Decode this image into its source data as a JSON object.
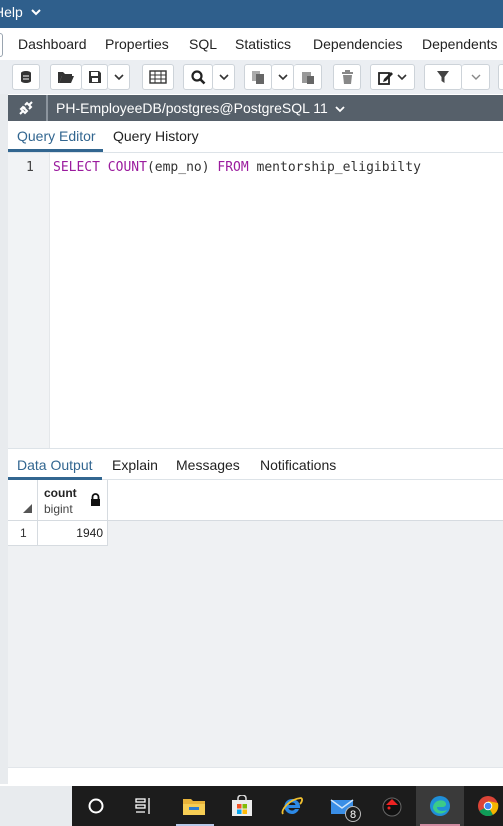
{
  "menu": {
    "help_label": "Help"
  },
  "panel_tabs": [
    {
      "label": "Dashboard"
    },
    {
      "label": "Properties"
    },
    {
      "label": "SQL"
    },
    {
      "label": "Statistics"
    },
    {
      "label": "Dependencies"
    },
    {
      "label": "Dependents"
    }
  ],
  "connection": {
    "label": "PH-EmployeeDB/postgres@PostgreSQL 11"
  },
  "editor_tabs": [
    {
      "label": "Query Editor",
      "active": true
    },
    {
      "label": "Query History",
      "active": false
    }
  ],
  "editor": {
    "line_number": "1",
    "tokens": {
      "select": "SELECT",
      "count": "COUNT",
      "args": "(emp_no)",
      "from": "FROM",
      "table": "mentorship_eligibilty"
    }
  },
  "results_tabs": [
    {
      "label": "Data Output",
      "active": true
    },
    {
      "label": "Explain",
      "active": false
    },
    {
      "label": "Messages",
      "active": false
    },
    {
      "label": "Notifications",
      "active": false
    }
  ],
  "grid": {
    "column": {
      "name": "count",
      "type": "bigint"
    },
    "rows": [
      {
        "row_number": "1",
        "count": "1940"
      }
    ]
  },
  "taskbar": {
    "mail_badge": "8"
  },
  "colors": {
    "menubar": "#2f5f8c",
    "connbar": "#56606a",
    "accent": "#326690",
    "keyword": "#9b1b9e",
    "taskbar": "#1c1c1c"
  },
  "icons": [
    "chevron-down-icon",
    "database-icon",
    "open-folder-icon",
    "save-icon",
    "grid-icon",
    "search-icon",
    "copy-icon",
    "paste-icon",
    "delete-icon",
    "edit-icon",
    "filter-icon",
    "plug-icon",
    "lock-icon",
    "start-circle-icon",
    "task-view-icon",
    "file-explorer-icon",
    "store-icon",
    "ie-icon",
    "mail-icon",
    "app-icon",
    "edge-icon",
    "chrome-icon"
  ]
}
